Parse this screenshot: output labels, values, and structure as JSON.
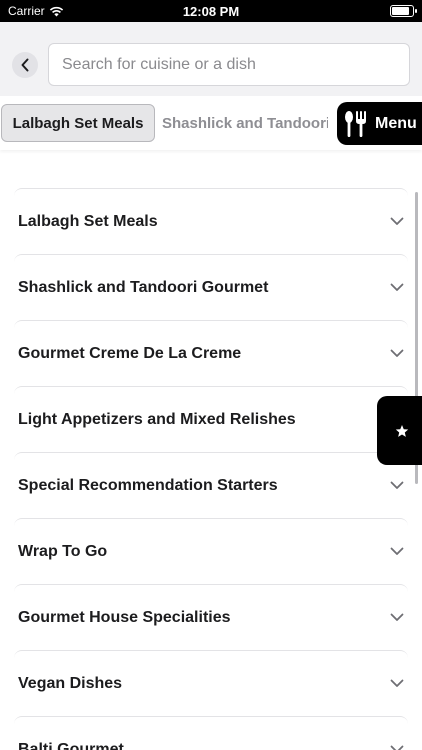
{
  "status_bar": {
    "carrier": "Carrier",
    "time": "12:08 PM",
    "battery_level": 0.9
  },
  "search": {
    "placeholder": "Search for cuisine or a dish",
    "value": ""
  },
  "tabs": {
    "active": "Lalbagh Set Meals",
    "next": "Shashlick and Tandoori Gourmet",
    "menu_label": "Menu"
  },
  "icons": {
    "back": "chevron-left-icon",
    "menu": "fork-knife-icon",
    "fab": "star-icon",
    "row": "chevron-down-icon"
  },
  "categories": [
    {
      "label": "Lalbagh Set Meals"
    },
    {
      "label": "Shashlick and Tandoori Gourmet"
    },
    {
      "label": "Gourmet Creme De La Creme"
    },
    {
      "label": "Light Appetizers and Mixed Relishes"
    },
    {
      "label": "Special Recommendation Starters"
    },
    {
      "label": "Wrap To Go"
    },
    {
      "label": "Gourmet House Specialities"
    },
    {
      "label": "Vegan Dishes"
    },
    {
      "label": "Balti Gourmet"
    }
  ],
  "colors": {
    "accent": "#000000",
    "header_bg": "#f2f2f4"
  }
}
